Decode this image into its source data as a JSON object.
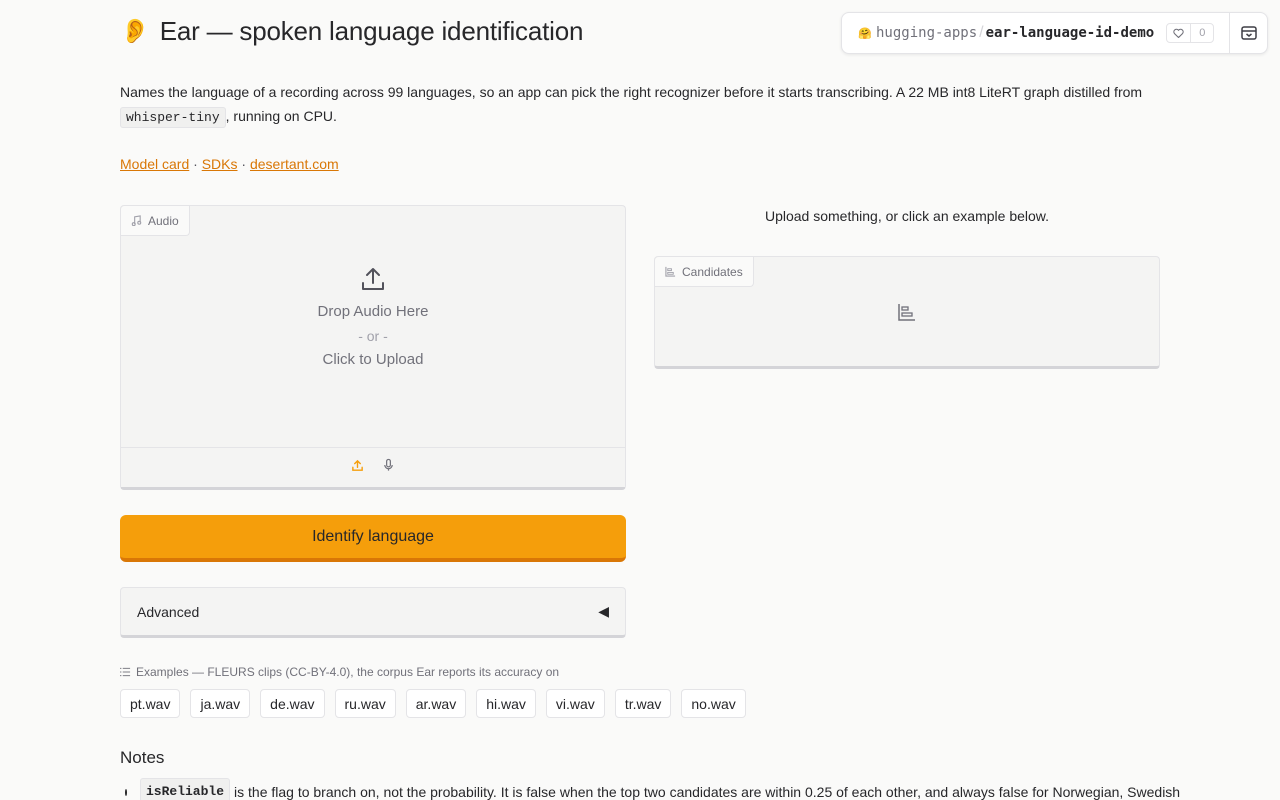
{
  "header": {
    "title_emoji": "👂",
    "title": "Ear — spoken language identification"
  },
  "description": {
    "text_before": "Names the language of a recording across 99 languages, so an app can pick the right recognizer before it starts transcribing. A 22 MB int8 LiteRT graph distilled from",
    "code": "whisper-tiny",
    "text_after": ", running on CPU."
  },
  "links": {
    "model_card": "Model card",
    "sdks": "SDKs",
    "site": "desertant.com",
    "separator": "·"
  },
  "space_badge": {
    "org": "hugging-apps",
    "slash": "/",
    "repo": "ear-language-id-demo",
    "likes": "0"
  },
  "audio_panel": {
    "label": "Audio",
    "drop_text": "Drop Audio Here",
    "or_text": "- or -",
    "click_text": "Click to Upload"
  },
  "status_text": "Upload something, or click an example below.",
  "candidates_panel": {
    "label": "Candidates"
  },
  "identify_button": "Identify language",
  "advanced": {
    "label": "Advanced",
    "toggle": "◀"
  },
  "examples": {
    "label": "Examples — FLEURS clips (CC-BY-4.0), the corpus Ear reports its accuracy on",
    "items": [
      "pt.wav",
      "ja.wav",
      "de.wav",
      "ru.wav",
      "ar.wav",
      "hi.wav",
      "vi.wav",
      "tr.wav",
      "no.wav"
    ]
  },
  "notes": {
    "heading": "Notes",
    "items": [
      {
        "code": "isReliable",
        "text": "is the flag to branch on, not the probability. It is false when the top two candidates are within 0.25 of each other, and always false for Norwegian, Swedish"
      }
    ]
  },
  "colors": {
    "accent": "#f59e0b",
    "link": "#d97706"
  }
}
